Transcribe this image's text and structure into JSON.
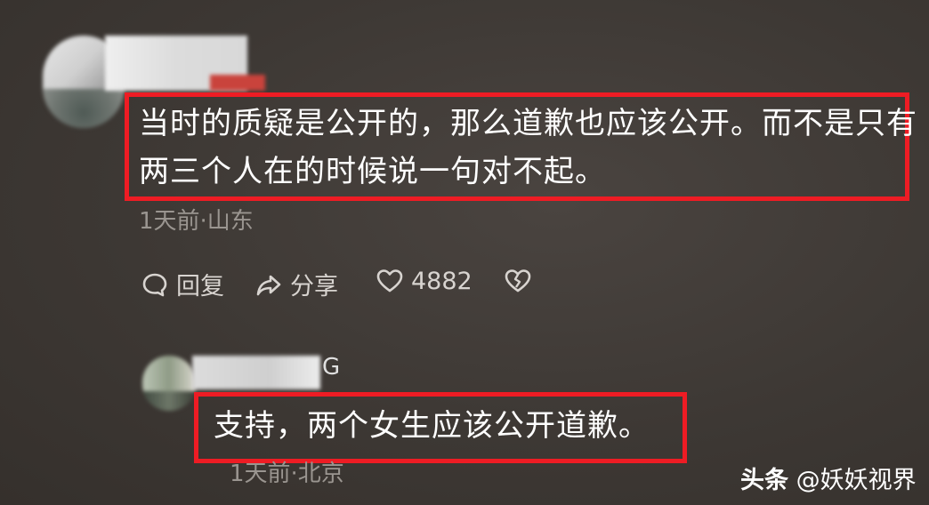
{
  "comments": [
    {
      "text_line1": "当时的质疑是公开的，那么道歉也应该公开。而不是只有",
      "text_line2": "两三个人在的时候说一句对不起。",
      "meta": "1天前·山东",
      "actions": {
        "reply": "回复",
        "share": "分享",
        "like_count": "4882"
      }
    },
    {
      "name_tail": "G",
      "text": "支持，两个女生应该公开道歉。",
      "meta": "1天前·北京"
    }
  ],
  "watermark": {
    "brand": "头条",
    "handle": "@妖妖视界"
  },
  "colors": {
    "highlight_box": "#ee1c24",
    "background": "#3d3834",
    "meta_text": "#9a9590"
  },
  "icons": [
    "comment-bubble-icon",
    "share-arrow-icon",
    "heart-icon",
    "broken-heart-icon"
  ]
}
